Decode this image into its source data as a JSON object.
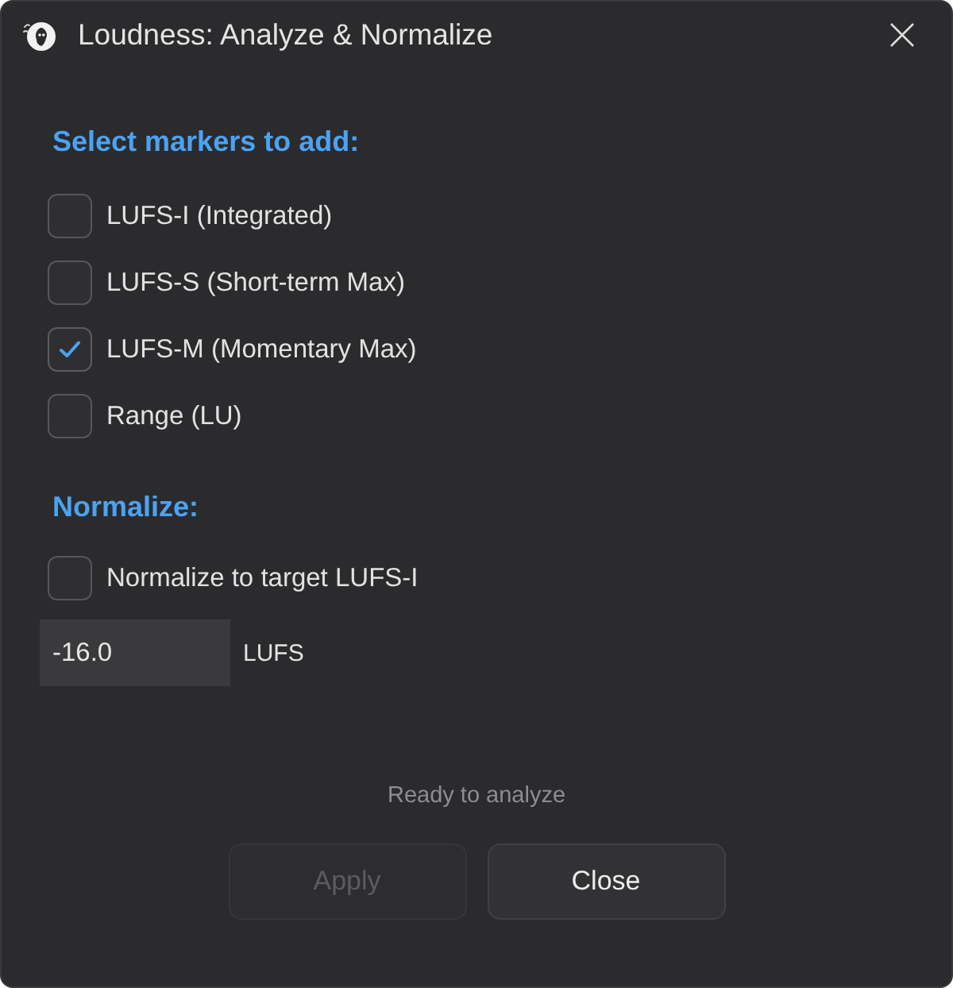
{
  "window": {
    "title": "Loudness: Analyze & Normalize"
  },
  "markers": {
    "heading": "Select markers to add:",
    "options": [
      {
        "label": "LUFS-I (Integrated)",
        "checked": false
      },
      {
        "label": "LUFS-S (Short-term Max)",
        "checked": false
      },
      {
        "label": "LUFS-M (Momentary Max)",
        "checked": true
      },
      {
        "label": "Range (LU)",
        "checked": false
      }
    ]
  },
  "normalize": {
    "heading": "Normalize:",
    "option": {
      "label": "Normalize to target LUFS-I",
      "checked": false
    },
    "target": {
      "value": "-16.0",
      "unit": "LUFS"
    }
  },
  "status": "Ready to analyze",
  "buttons": [
    {
      "label": "Apply",
      "disabled": true
    },
    {
      "label": "Close",
      "disabled": false
    }
  ]
}
